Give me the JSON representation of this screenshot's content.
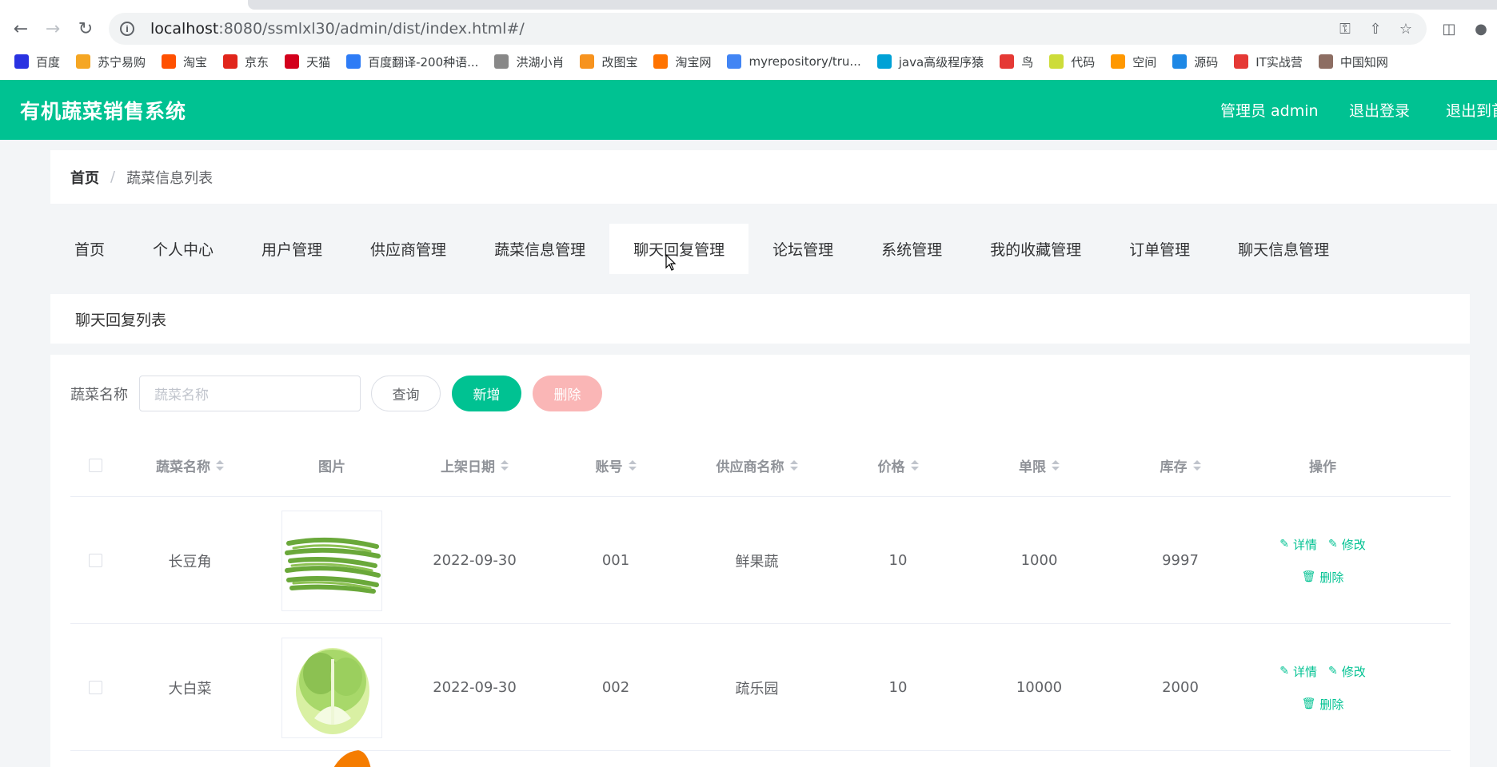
{
  "browser": {
    "url_host": "localhost",
    "url_rest": ":8080/ssmlxl30/admin/dist/index.html#/",
    "bookmarks": [
      {
        "label": "百度",
        "icon": "baidu-icon",
        "color": "#2932e1"
      },
      {
        "label": "苏宁易购",
        "icon": "suning-icon",
        "color": "#f5a623"
      },
      {
        "label": "淘宝",
        "icon": "taobao-icon",
        "color": "#ff5000"
      },
      {
        "label": "京东",
        "icon": "jd-icon",
        "color": "#e1251b"
      },
      {
        "label": "天猫",
        "icon": "tmall-icon",
        "color": "#d3001c"
      },
      {
        "label": "百度翻译-200种语...",
        "icon": "translate-icon",
        "color": "#2e7cf6"
      },
      {
        "label": "洪湖小肖",
        "icon": "bird-icon",
        "color": "#888888"
      },
      {
        "label": "改图宝",
        "icon": "gaitubao-icon",
        "color": "#f7931e"
      },
      {
        "label": "淘宝网",
        "icon": "taobao-net-icon",
        "color": "#ff7300"
      },
      {
        "label": "myrepository/tru...",
        "icon": "chrome-icon",
        "color": "#4285f4"
      },
      {
        "label": "java高级程序猿",
        "icon": "bilibili-icon",
        "color": "#00a1d6"
      },
      {
        "label": "鸟",
        "icon": "bird-red-icon",
        "color": "#e53935"
      },
      {
        "label": "代码",
        "icon": "code-icon",
        "color": "#cddc39"
      },
      {
        "label": "空间",
        "icon": "space-icon",
        "color": "#ff9800"
      },
      {
        "label": "源码",
        "icon": "docker-icon",
        "color": "#1e88e5"
      },
      {
        "label": "IT实战营",
        "icon": "it-icon",
        "color": "#e53935"
      },
      {
        "label": "中国知网",
        "icon": "cnki-icon",
        "color": "#8d6e63"
      }
    ]
  },
  "header": {
    "title": "有机蔬菜销售系统",
    "user": "管理员 admin",
    "logout": "退出登录",
    "exit_home": "退出到首"
  },
  "breadcrumb": {
    "home": "首页",
    "separator": "/",
    "current": "蔬菜信息列表"
  },
  "menu": [
    {
      "label": "首页"
    },
    {
      "label": "个人中心"
    },
    {
      "label": "用户管理"
    },
    {
      "label": "供应商管理"
    },
    {
      "label": "蔬菜信息管理"
    },
    {
      "label": "聊天回复管理",
      "active": true
    },
    {
      "label": "论坛管理"
    },
    {
      "label": "系统管理"
    },
    {
      "label": "我的收藏管理"
    },
    {
      "label": "订单管理"
    },
    {
      "label": "聊天信息管理"
    }
  ],
  "section": {
    "title": "聊天回复列表"
  },
  "search": {
    "label": "蔬菜名称",
    "placeholder": "蔬菜名称",
    "query_button": "查询",
    "add_button": "新增",
    "delete_button": "删除"
  },
  "table": {
    "columns": [
      "蔬菜名称",
      "图片",
      "上架日期",
      "账号",
      "供应商名称",
      "价格",
      "单限",
      "库存",
      "操作"
    ],
    "rows": [
      {
        "name": "长豆角",
        "image": "green-beans",
        "date": "2022-09-30",
        "account": "001",
        "supplier": "鲜果蔬",
        "price": "10",
        "limit": "1000",
        "stock": "9997"
      },
      {
        "name": "大白菜",
        "image": "cabbage",
        "date": "2022-09-30",
        "account": "002",
        "supplier": "疏乐园",
        "price": "10",
        "limit": "10000",
        "stock": "2000"
      }
    ],
    "ops": {
      "detail": "详情",
      "edit": "修改",
      "delete": "删除"
    }
  },
  "colors": {
    "primary": "#00c292",
    "danger_disabled": "#fab6b6"
  }
}
